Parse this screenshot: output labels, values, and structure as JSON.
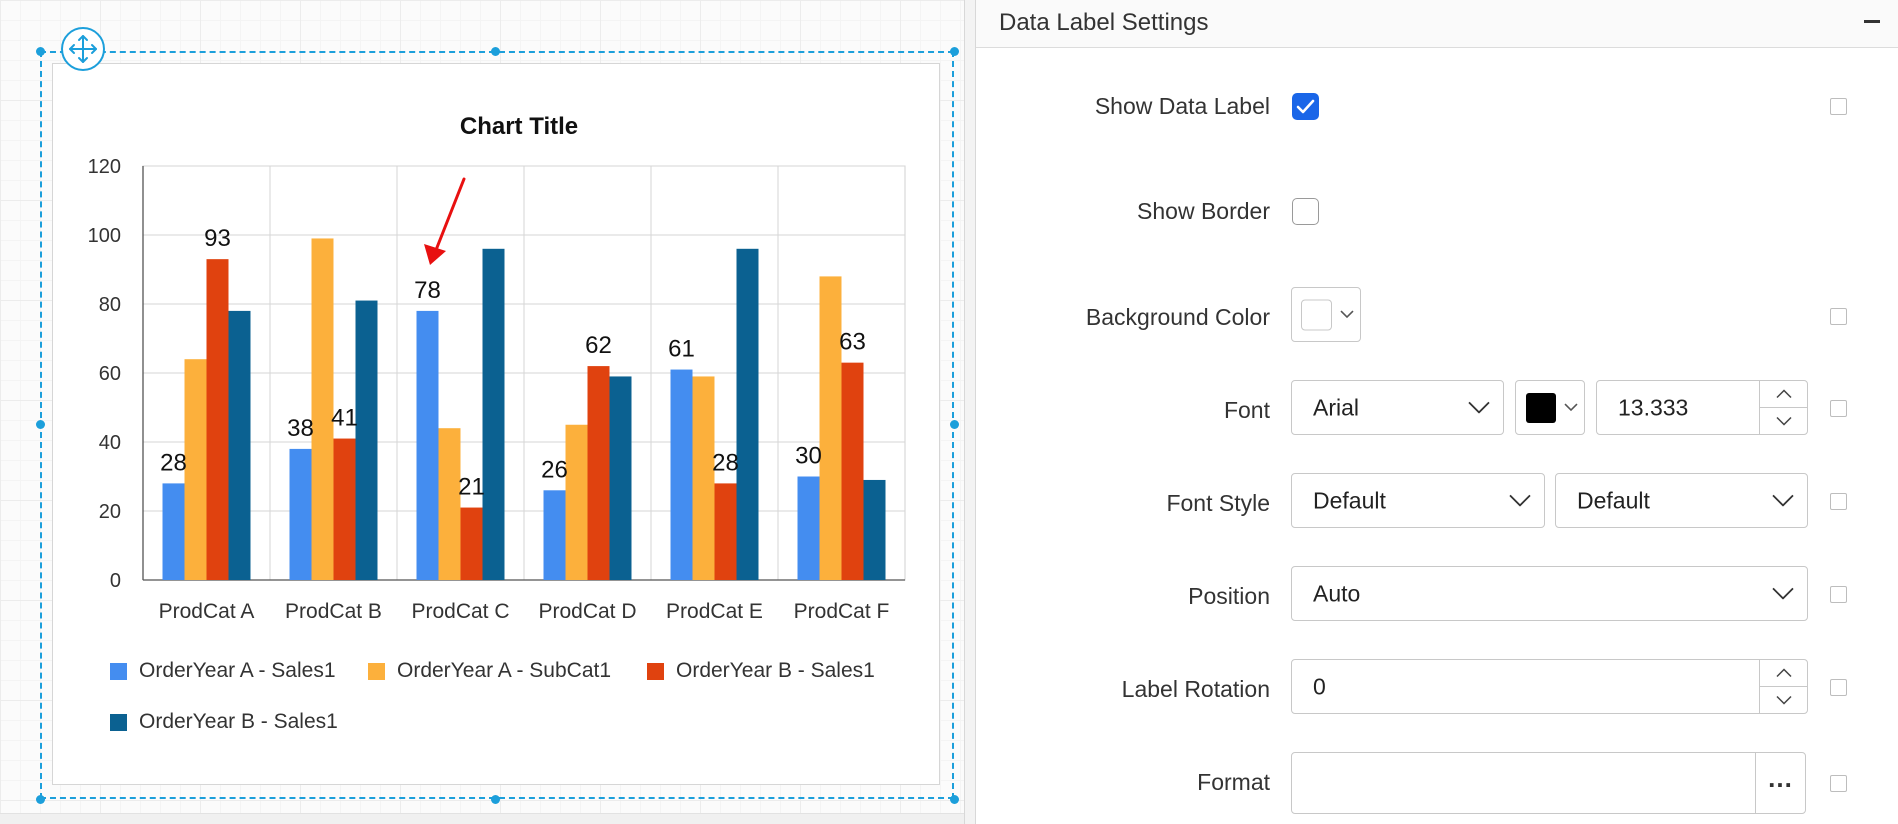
{
  "panel": {
    "title": "Data Label Settings",
    "rows": {
      "show_data_label": {
        "label": "Show Data Label",
        "checked": true
      },
      "show_border": {
        "label": "Show Border",
        "checked": false
      },
      "background_color": {
        "label": "Background Color",
        "value": "#ffffff"
      },
      "font": {
        "label": "Font",
        "family": "Arial",
        "color": "#000000",
        "size": "13.333"
      },
      "font_style": {
        "label": "Font Style",
        "style": "Default",
        "weight": "Default"
      },
      "position": {
        "label": "Position",
        "value": "Auto"
      },
      "label_rotation": {
        "label": "Label Rotation",
        "value": "0"
      },
      "format": {
        "label": "Format",
        "value": "",
        "button": "..."
      }
    }
  },
  "chart_data": {
    "type": "bar",
    "title": "Chart Title",
    "categories": [
      "ProdCat A",
      "ProdCat B",
      "ProdCat C",
      "ProdCat D",
      "ProdCat E",
      "ProdCat F"
    ],
    "ylim": [
      0,
      120
    ],
    "yticks": [
      0,
      20,
      40,
      60,
      80,
      100,
      120
    ],
    "grid": true,
    "legend_position": "bottom",
    "series": [
      {
        "name": "OrderYear A - Sales1",
        "color": "#448df0",
        "values": [
          28,
          38,
          78,
          26,
          61,
          30
        ]
      },
      {
        "name": "OrderYear A - SubCat1",
        "color": "#fcb03c",
        "values": [
          64,
          99,
          44,
          45,
          59,
          88
        ]
      },
      {
        "name": "OrderYear B - Sales1",
        "color": "#e0420f",
        "values": [
          93,
          41,
          21,
          62,
          28,
          63
        ]
      },
      {
        "name": "OrderYear B - Sales1",
        "color": "#0b6191",
        "values": [
          78,
          81,
          96,
          59,
          96,
          29
        ]
      }
    ],
    "data_labels": [
      {
        "category": "ProdCat A",
        "series": 0,
        "text": "28"
      },
      {
        "category": "ProdCat A",
        "series": 2,
        "text": "93"
      },
      {
        "category": "ProdCat B",
        "series": 0,
        "text": "38"
      },
      {
        "category": "ProdCat B",
        "series": 2,
        "text": "41"
      },
      {
        "category": "ProdCat C",
        "series": 0,
        "text": "78"
      },
      {
        "category": "ProdCat C",
        "series": 2,
        "text": "21"
      },
      {
        "category": "ProdCat D",
        "series": 0,
        "text": "26"
      },
      {
        "category": "ProdCat D",
        "series": 2,
        "text": "62"
      },
      {
        "category": "ProdCat E",
        "series": 0,
        "text": "61"
      },
      {
        "category": "ProdCat E",
        "series": 2,
        "text": "28"
      },
      {
        "category": "ProdCat F",
        "series": 0,
        "text": "30"
      },
      {
        "category": "ProdCat F",
        "series": 2,
        "text": "63"
      }
    ],
    "annotation": {
      "type": "arrow",
      "color": "#e81010",
      "target": "ProdCat C data label 78"
    }
  },
  "icons": {
    "move": "move-arrows-icon",
    "collapse": "minus-icon",
    "check": "checkmark-icon",
    "chevron": "chevron-down-icon",
    "spin_up": "chevron-up-icon",
    "spin_down": "chevron-down-icon"
  },
  "colors": {
    "selection": "#1c9fdb",
    "checkbox_accent": "#1a66e8"
  }
}
